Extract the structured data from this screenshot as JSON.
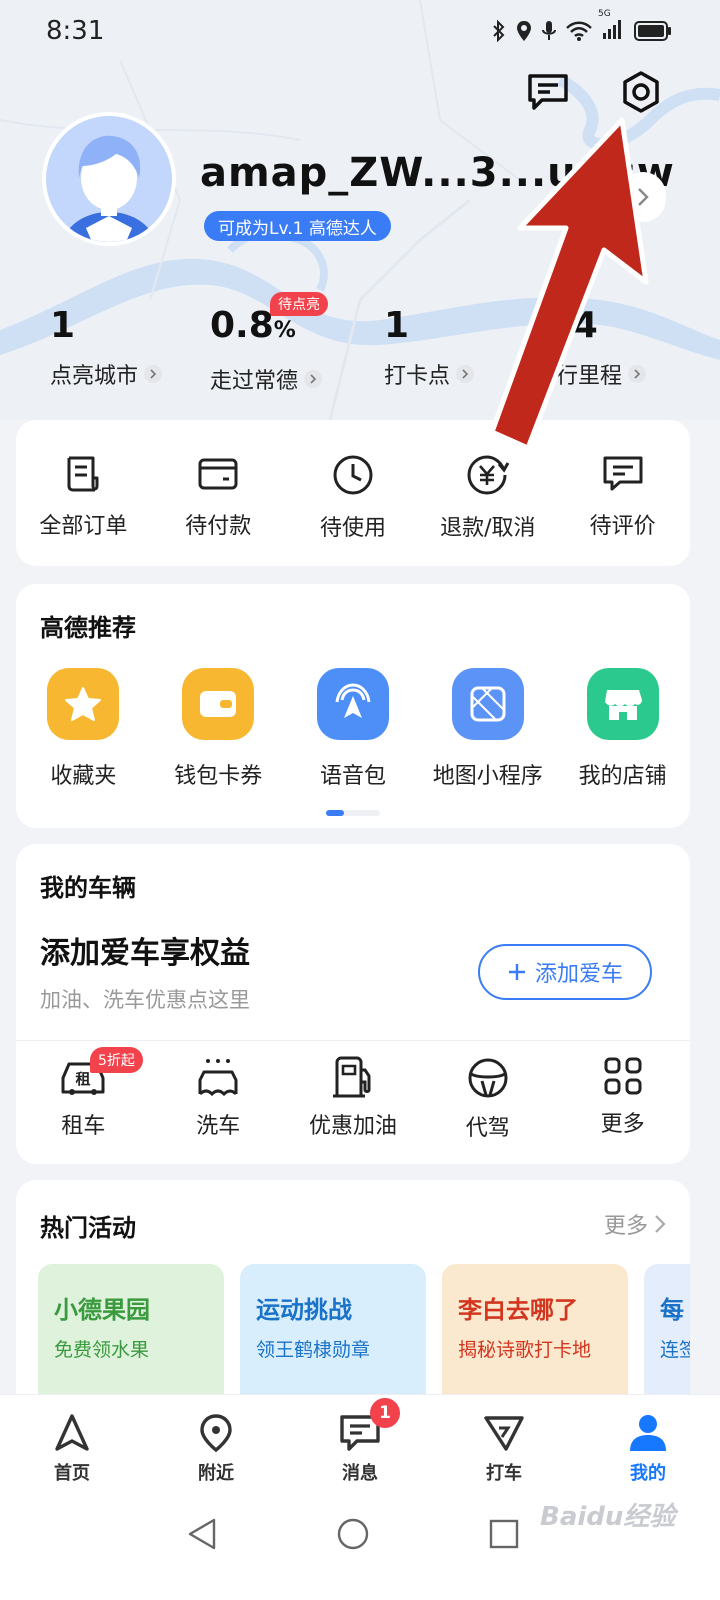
{
  "status_bar": {
    "time": "8:31",
    "network_label": "5G",
    "icons": [
      "bluetooth-icon",
      "location-icon",
      "mic-icon",
      "wifi-icon",
      "signal-icon",
      "battery-icon"
    ]
  },
  "header": {
    "message_icon": "message-icon",
    "settings_icon": "settings-icon"
  },
  "profile": {
    "username": "amap_ZW...3...urisw",
    "level_badge": "可成为Lv.1 高德达人",
    "pending_badge": "待点亮",
    "stats": [
      {
        "value": "1",
        "label": "点亮城市"
      },
      {
        "value": "0.8",
        "unit": "%",
        "label": "走过常德"
      },
      {
        "value": "1",
        "label": "打卡点"
      },
      {
        "value": "3.4",
        "label": "出行里程"
      }
    ]
  },
  "orders": [
    {
      "label": "全部订单",
      "icon": "receipt-icon"
    },
    {
      "label": "待付款",
      "icon": "wallet-icon"
    },
    {
      "label": "待使用",
      "icon": "clock-icon"
    },
    {
      "label": "退款/取消",
      "icon": "refund-icon"
    },
    {
      "label": "待评价",
      "icon": "comment-icon"
    }
  ],
  "recommend": {
    "title": "高德推荐",
    "items": [
      {
        "label": "收藏夹",
        "icon": "star-icon",
        "color": "#f7b731"
      },
      {
        "label": "钱包卡券",
        "icon": "wallet-icon",
        "color": "#f7b731"
      },
      {
        "label": "语音包",
        "icon": "voice-icon",
        "color": "#4e8ef7"
      },
      {
        "label": "地图小程序",
        "icon": "mini-program-icon",
        "color": "#5b93f7"
      },
      {
        "label": "我的店铺",
        "icon": "shop-icon",
        "color": "#2cc98f"
      }
    ]
  },
  "vehicle": {
    "title": "我的车辆",
    "headline": "添加爱车享权益",
    "subtext": "加油、洗车优惠点这里",
    "add_button": "添加爱车",
    "discount_badge": "5折起",
    "rent_glyph": "租",
    "services": [
      {
        "label": "租车",
        "icon": "car-rental-icon"
      },
      {
        "label": "洗车",
        "icon": "car-wash-icon"
      },
      {
        "label": "优惠加油",
        "icon": "fuel-icon"
      },
      {
        "label": "代驾",
        "icon": "steering-wheel-icon"
      },
      {
        "label": "更多",
        "icon": "grid-icon"
      }
    ]
  },
  "hot": {
    "title": "热门活动",
    "more": "更多",
    "promos": [
      {
        "title": "小德果园",
        "sub": "免费领水果",
        "bg": "#dff2dc",
        "color": "#3a9a3e"
      },
      {
        "title": "运动挑战",
        "sub": "领王鹤棣勋章",
        "bg": "#d9eefc",
        "color": "#1a73c8"
      },
      {
        "title": "李白去哪了",
        "sub": "揭秘诗歌打卡地",
        "bg": "#fbe9cf",
        "color": "#d2361f"
      },
      {
        "title": "每",
        "sub": "连签",
        "bg": "#e3edfb",
        "color": "#1a73c8"
      }
    ]
  },
  "bottom_nav": {
    "items": [
      {
        "label": "首页",
        "icon": "navigate-icon"
      },
      {
        "label": "附近",
        "icon": "pin-icon"
      },
      {
        "label": "消息",
        "icon": "message-icon"
      },
      {
        "label": "打车",
        "icon": "taxi-icon"
      },
      {
        "label": "我的",
        "icon": "user-icon"
      }
    ],
    "active": "我的",
    "message_badge": "1"
  },
  "watermark": "Baidu经验",
  "colors": {
    "accent": "#1677ff",
    "badge_red": "#f2434d",
    "annotation_arrow": "#c0281c"
  }
}
